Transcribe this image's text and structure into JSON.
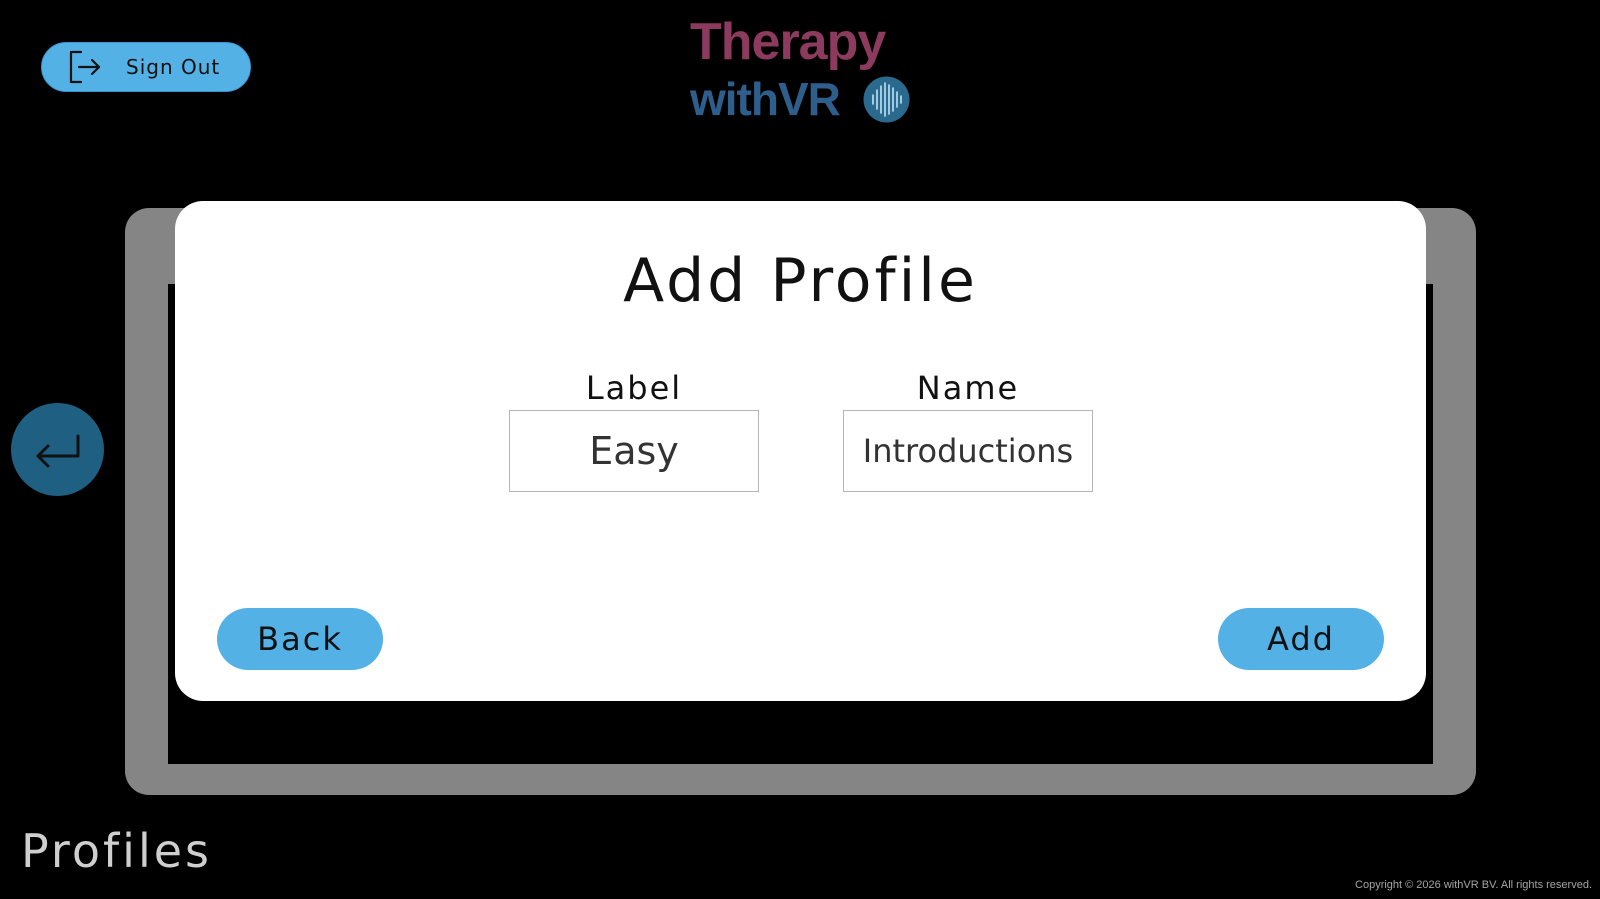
{
  "header": {
    "sign_out_label": "Sign Out",
    "logo_line1": "Therapy",
    "logo_line2": "withVR"
  },
  "dialog": {
    "title": "Add Profile",
    "label_field": {
      "label": "Label",
      "value": "Easy"
    },
    "name_field": {
      "label": "Name",
      "value": "Introductions"
    },
    "back_label": "Back",
    "add_label": "Add"
  },
  "footer": {
    "page_title": "Profiles",
    "copyright": "Copyright © 2026 withVR BV. All rights reserved."
  },
  "colors": {
    "accent_button": "#54b1e6",
    "logo_primary": "#8c3a5e",
    "logo_secondary": "#2e5f8c",
    "nav_circle": "#1e5f82",
    "panel_frame": "#858585"
  },
  "icons": {
    "sign_out": "sign-out-icon",
    "back_arrow": "return-arrow-icon",
    "logo_emblem": "sound-wave-emblem-icon"
  }
}
